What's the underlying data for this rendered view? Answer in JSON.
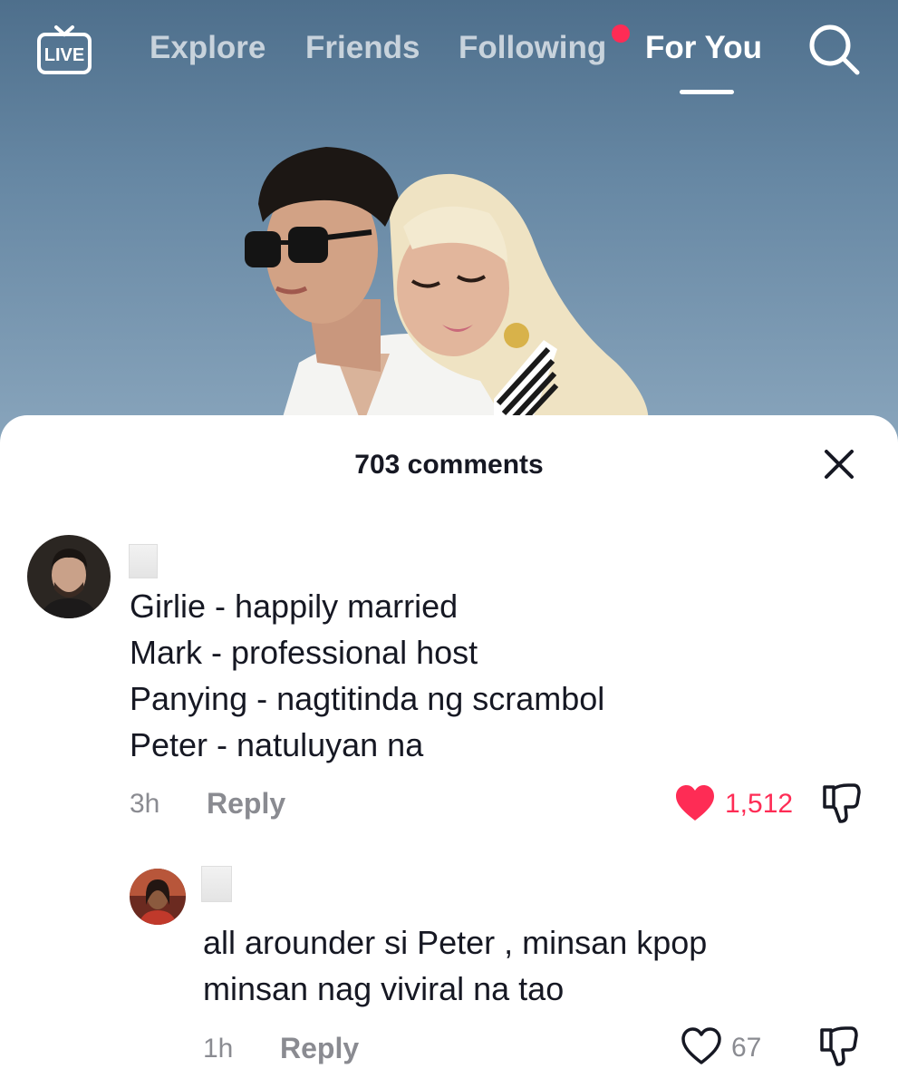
{
  "nav": {
    "live_label": "LIVE",
    "tabs": [
      {
        "label": "Explore",
        "active": false
      },
      {
        "label": "Friends",
        "active": false
      },
      {
        "label": "Following",
        "active": false,
        "has_notification_dot": true
      },
      {
        "label": "For You",
        "active": true
      }
    ],
    "search_icon": "search-icon",
    "notification_color": "#fe2c55"
  },
  "comments_sheet": {
    "title": "703 comments",
    "close_icon": "close-icon",
    "comments": [
      {
        "username": "",
        "text_lines": [
          "Girlie - happily married",
          "Mark - professional host",
          "Panying - nagtitinda ng scrambol",
          "Peter - natuluyan na"
        ],
        "time": "3h",
        "reply_label": "Reply",
        "likes": "1,512",
        "liked": true,
        "like_color": "#fe2c55"
      },
      {
        "username": "",
        "text_lines": [
          "all arounder si Peter , minsan kpop",
          "minsan nag viviral na tao"
        ],
        "time": "1h",
        "reply_label": "Reply",
        "likes": "67",
        "liked": false
      }
    ]
  }
}
